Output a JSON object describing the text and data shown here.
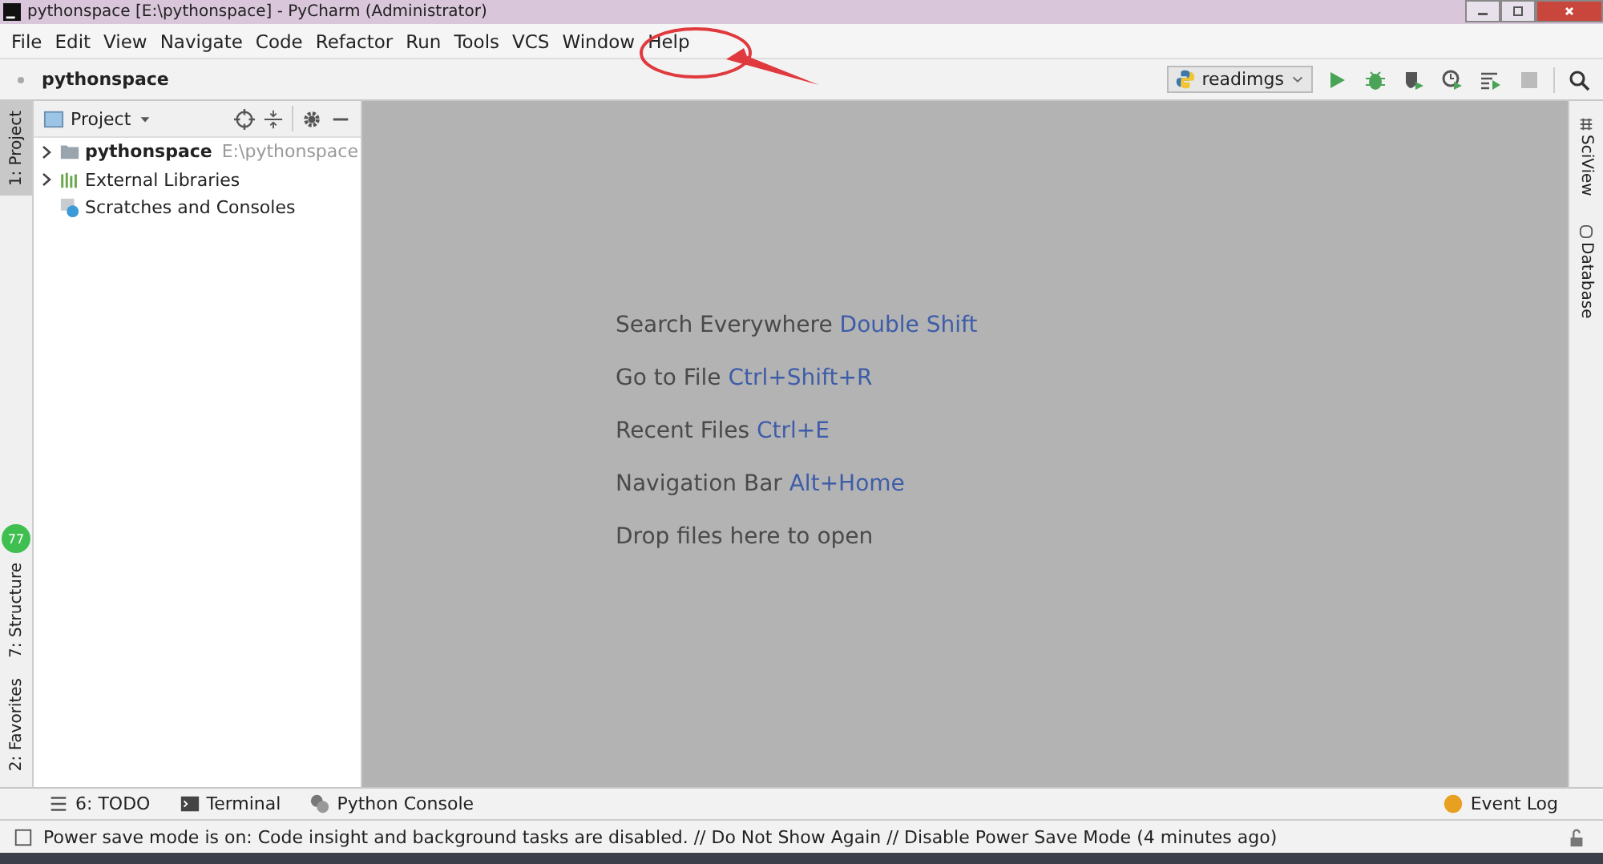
{
  "window": {
    "title": "pythonspace [E:\\pythonspace] - PyCharm (Administrator)"
  },
  "menu": [
    "File",
    "Edit",
    "View",
    "Navigate",
    "Code",
    "Refactor",
    "Run",
    "Tools",
    "VCS",
    "Window",
    "Help"
  ],
  "nav_bar": {
    "breadcrumb": "pythonspace",
    "run_config": "readimgs"
  },
  "left_tool_tabs": [
    {
      "label": "1: Project",
      "selected": true
    },
    {
      "label": "7: Structure",
      "selected": false
    },
    {
      "label": "2: Favorites",
      "selected": false
    }
  ],
  "floating_badge": "77",
  "right_tool_tabs": [
    {
      "label": "SciView"
    },
    {
      "label": "Database"
    }
  ],
  "project_panel": {
    "title": "Project",
    "tree": [
      {
        "name": "pythonspace",
        "path": "E:\\pythonspace",
        "kind": "folder",
        "expandable": true
      },
      {
        "name": "External Libraries",
        "kind": "libraries",
        "expandable": true
      },
      {
        "name": "Scratches and Consoles",
        "kind": "scratches",
        "expandable": false
      }
    ]
  },
  "editor_hints": [
    {
      "text": "Search Everywhere",
      "shortcut": "Double Shift"
    },
    {
      "text": "Go to File",
      "shortcut": "Ctrl+Shift+R"
    },
    {
      "text": "Recent Files",
      "shortcut": "Ctrl+E"
    },
    {
      "text": "Navigation Bar",
      "shortcut": "Alt+Home"
    },
    {
      "text": "Drop files here to open"
    }
  ],
  "bottom_tool_tabs": [
    "6: TODO",
    "Terminal",
    "Python Console"
  ],
  "event_log": "Event Log",
  "status_bar": "Power save mode is on: Code insight and background tasks are disabled. // Do Not Show Again // Disable Power Save Mode (4 minutes ago)"
}
